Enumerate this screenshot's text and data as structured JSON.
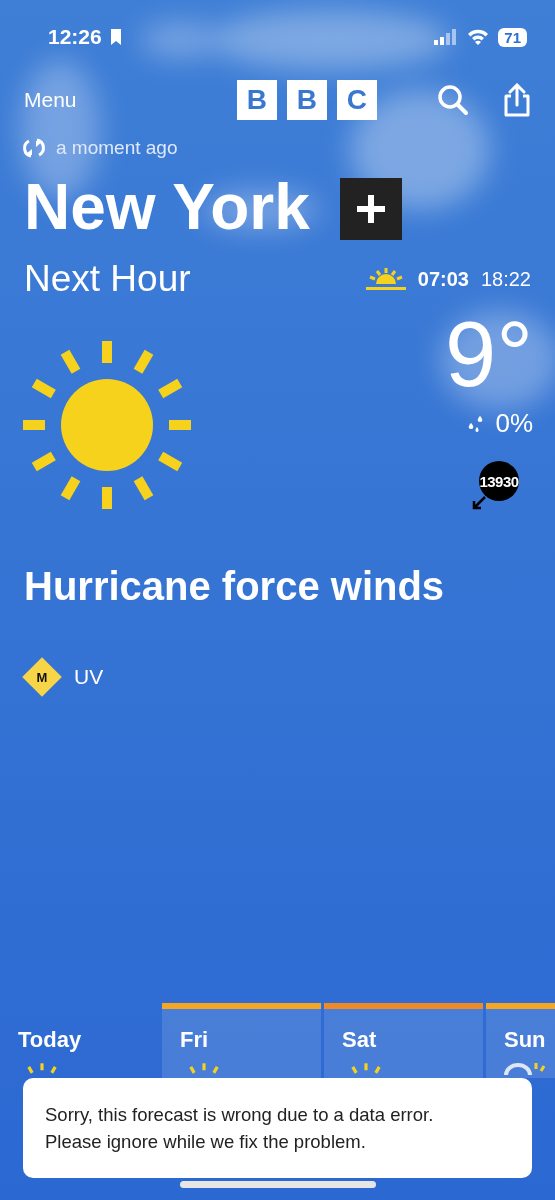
{
  "status_bar": {
    "time": "12:26",
    "battery": "71"
  },
  "nav": {
    "menu": "Menu",
    "logo": [
      "B",
      "B",
      "C"
    ]
  },
  "updated": "a moment ago",
  "location": {
    "name": "New York"
  },
  "next_hour": {
    "label": "Next Hour",
    "sunrise": "07:03",
    "sunset": "18:22",
    "temperature": "9°",
    "precipitation": "0%",
    "wind_speed": "13930",
    "description": "Hurricane force winds",
    "uv_level": "M",
    "uv_label": "UV"
  },
  "days": [
    {
      "name": "Today",
      "selected": true
    },
    {
      "name": "Fri",
      "selected": false,
      "color": "#f5a623"
    },
    {
      "name": "Sat",
      "selected": false,
      "color": "#f08a24"
    },
    {
      "name": "Sun",
      "selected": false,
      "color": "#f5a623",
      "kind": "cloudy"
    }
  ],
  "toast": "Sorry, this forecast is wrong due to a data error. Please ignore while we fix the problem."
}
